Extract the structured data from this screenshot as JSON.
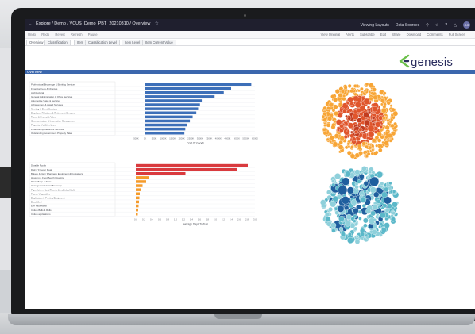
{
  "window": {
    "breadcrumb": "Explore / Demo / VCUS_Demo_PBT_20210310 / Overview",
    "right_items": [
      "Viewing Layouts",
      "Data Sources"
    ],
    "avatar_initials": "CG"
  },
  "toolbar": {
    "left_items": [
      "Undo",
      "Redo",
      "Revert",
      "Refresh",
      "Pause"
    ],
    "right_items": [
      "View Original",
      "Alerts",
      "Subscribe",
      "Edit",
      "Share",
      "Download",
      "Comments",
      "Full Screen"
    ]
  },
  "tabs": [
    "Overview",
    "Classification",
    "Item",
    "Classification Level",
    "Item Level",
    "Item Current Value"
  ],
  "logo": {
    "text": "genesis",
    "color": "#2a2d5e",
    "mark_colors": [
      "#6cc04a",
      "#2a2d5e"
    ]
  },
  "overview_label": "Overview",
  "colors": {
    "header_bar": "#3b67ad",
    "bar_blue": "#3d6fb8",
    "bar_red": "#d93a3e",
    "bar_orange": "#f59b2b",
    "bubble_orange": "#f7a536",
    "bubble_red": "#e0552c",
    "bubble_teal": "#5bb8c9",
    "bubble_navy": "#1f5f9e"
  },
  "chart_data": [
    {
      "type": "bar",
      "orientation": "horizontal",
      "categories": [
        "Professional Brokerage & Banking Services",
        "Financial Fees & Charges",
        "Architectural",
        "General Administration & Office Services",
        "Automotive Sales & Services",
        "Achievement & Award Services",
        "Meeting & Event Services",
        "Employee Relations & Retirement Services",
        "Travel & Financial Aides",
        "Communication & Information Management",
        "Property & Utilities Lines",
        "Financial Operations & Services",
        "Outstanding Government Property Sales"
      ],
      "values": [
        5800,
        4700,
        4300,
        3800,
        3100,
        3000,
        2900,
        2800,
        2600,
        2450,
        2300,
        2200,
        2150
      ],
      "xlabel": "Cost Of Goods",
      "xticks": [
        "-500K",
        "0K",
        "500K",
        "1000K",
        "1500K",
        "2000K",
        "2500K",
        "3000K",
        "3500K",
        "4000K",
        "4500K",
        "5000K",
        "5500K",
        "6000K"
      ],
      "xlim": [
        -500,
        6000
      ],
      "color": "#3d6fb8"
    },
    {
      "type": "bar",
      "orientation": "horizontal",
      "categories": [
        "Durable Foods",
        "Dairy / Freezer Meat",
        "Bakery & Deli / Pharmacy Equipment & Containers",
        "Housing & Food Beach Roasting",
        "Picnic Bags & Tents",
        "Homogenized Infant Beverage",
        "Paper Linen Hand Towels & Individual Rolls",
        "Frozen Vegetables",
        "Duplicators & Printing Equipment",
        "Emulsified",
        "Eye Face Mask",
        "Cotton Balls & Rolls",
        "Cotton applications"
      ],
      "values": [
        2.82,
        2.55,
        1.25,
        0.33,
        0.26,
        0.17,
        0.14,
        0.1,
        0.09,
        0.08,
        0.07,
        0.06,
        0.05
      ],
      "xlabel": "Average Days To Turn",
      "xticks": [
        "0.0",
        "0.2",
        "0.4",
        "0.6",
        "0.8",
        "1.0",
        "1.2",
        "1.4",
        "1.6",
        "1.8",
        "2.0",
        "2.2",
        "2.4",
        "2.6",
        "2.8",
        "3.0"
      ],
      "xlim": [
        0,
        3.0
      ],
      "highlight_colors": [
        "#d93a3e",
        "#d93a3e",
        "#d93a3e",
        "#f59b2b"
      ],
      "default_color": "#f59b2b"
    }
  ]
}
